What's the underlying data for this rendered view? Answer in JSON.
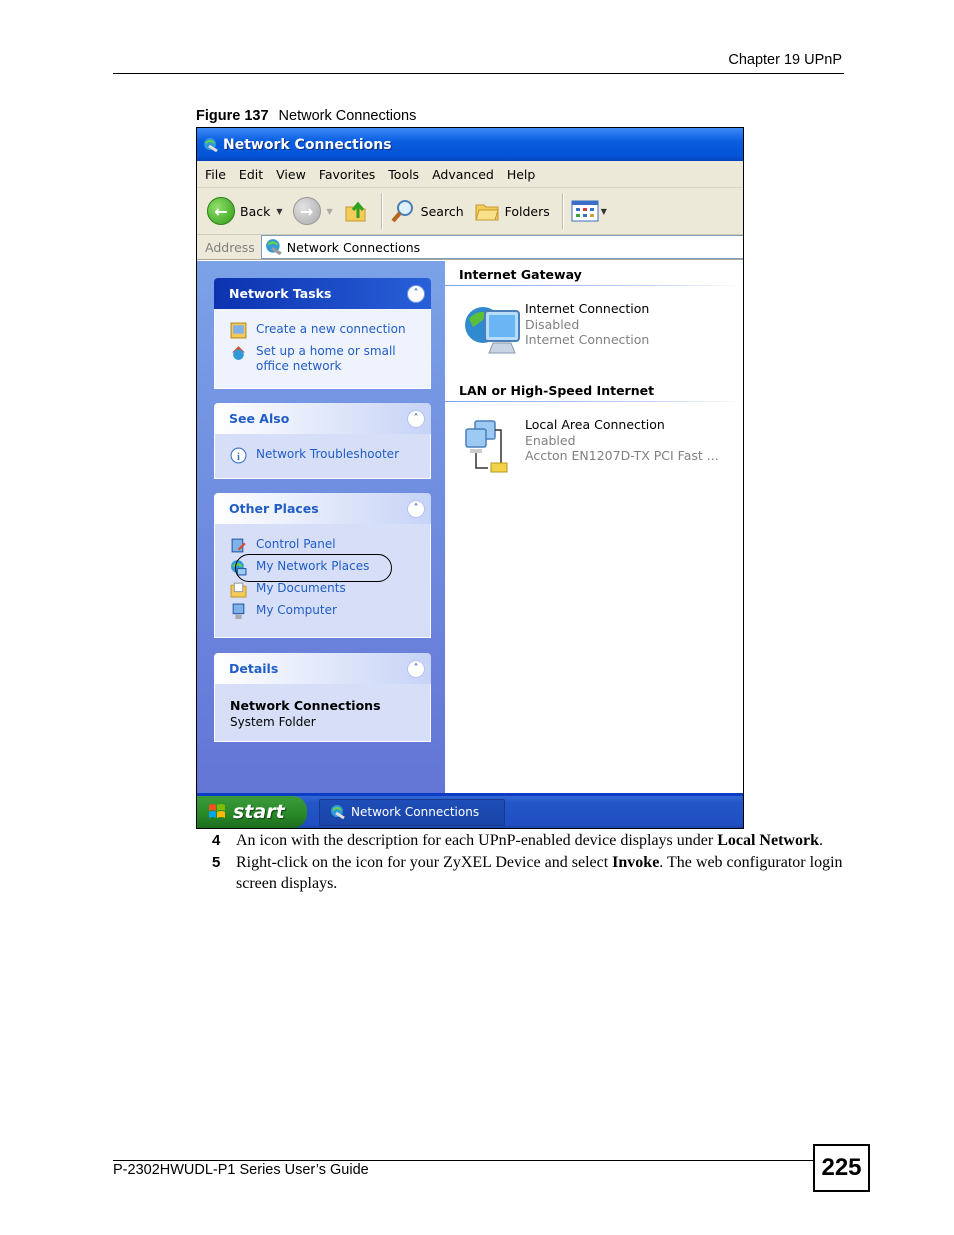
{
  "page_header": {
    "chapter": "Chapter 19 UPnP"
  },
  "figure": {
    "label": "Figure 137",
    "title": "Network Connections"
  },
  "window": {
    "title": "Network Connections",
    "menu": [
      "File",
      "Edit",
      "View",
      "Favorites",
      "Tools",
      "Advanced",
      "Help"
    ],
    "toolbar": {
      "back": "Back",
      "search": "Search",
      "folders": "Folders"
    },
    "address": {
      "label": "Address",
      "value": "Network Connections"
    },
    "panels": {
      "network_tasks": {
        "title": "Network Tasks",
        "items": [
          "Create a new connection",
          "Set up a home or small office network"
        ]
      },
      "see_also": {
        "title": "See Also",
        "items": [
          "Network Troubleshooter"
        ]
      },
      "other_places": {
        "title": "Other Places",
        "items": [
          "Control Panel",
          "My Network Places",
          "My Documents",
          "My Computer"
        ],
        "highlighted": "My Network Places"
      },
      "details": {
        "title": "Details",
        "name": "Network Connections",
        "type": "System Folder"
      }
    },
    "groups": [
      {
        "title": "Internet Gateway",
        "connection": {
          "name": "Internet Connection",
          "status": "Disabled",
          "device": "Internet Connection"
        }
      },
      {
        "title": "LAN or High-Speed Internet",
        "connection": {
          "name": "Local Area Connection",
          "status": "Enabled",
          "device": "Accton EN1207D-TX PCI Fast ..."
        }
      }
    ],
    "taskbar": {
      "start": "start",
      "task": "Network Connections"
    }
  },
  "steps": [
    {
      "num": "4",
      "pre": "An icon with the description for each UPnP-enabled device displays under ",
      "bold": "Local Network",
      "post": "."
    },
    {
      "num": "5",
      "pre": "Right-click on the icon for your ZyXEL Device and select ",
      "bold": "Invoke",
      "post": ". The web configurator login screen displays."
    }
  ],
  "page_footer": {
    "guide": "P-2302HWUDL-P1 Series User’s Guide",
    "page_number": "225"
  }
}
